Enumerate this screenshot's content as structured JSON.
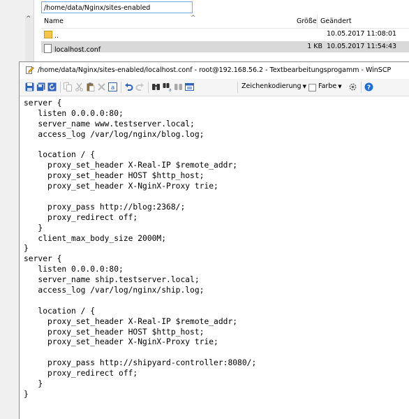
{
  "file_panel": {
    "path": "/home/data/Nginx/sites-enabled",
    "columns": {
      "name": "Name",
      "size": "Größe",
      "changed": "Geändert"
    },
    "rows": [
      {
        "name": "..",
        "size": "",
        "changed": "10.05.2017 11:08:01"
      },
      {
        "name": "localhost.conf",
        "size": "1 KB",
        "changed": "10.05.2017 11:54:43"
      }
    ]
  },
  "editor": {
    "title": "/home/data/Nginx/sites-enabled/localhost.conf - root@192.168.56.2 - Textbearbeitungsprogamm - WinSCP",
    "toolbar": {
      "encoding_label": "Zeichenkodierung",
      "color_label": "Farbe",
      "icons": [
        "save-icon",
        "save-all-icon",
        "reload-icon",
        "copy-icon",
        "cut-icon",
        "paste-icon",
        "delete-icon",
        "select-all-icon",
        "undo-icon",
        "redo-icon",
        "find-icon",
        "replace-icon",
        "find-next-icon",
        "goto-line-icon",
        "settings-icon",
        "help-icon"
      ]
    },
    "lines": [
      "server {",
      "   listen 0.0.0.0:80;",
      "   server_name www.testserver.local;",
      "   access_log /var/log/nginx/blog.log;",
      "",
      "   location / {",
      "     proxy_set_header X-Real-IP $remote_addr;",
      "     proxy_set_header HOST $http_host;",
      "     proxy_set_header X-NginX-Proxy trie;",
      "",
      "     proxy_pass http://blog:2368/;",
      "     proxy_redirect off;",
      "   }",
      "   client_max_body_size 2000M;",
      "}",
      "server {",
      "   listen 0.0.0.0:80;",
      "   server_name ship.testserver.local;",
      "   access_log /var/log/nginx/ship.log;",
      "",
      "   location / {",
      "     proxy_set_header X-Real-IP $remote_addr;",
      "     proxy_set_header HOST $http_host;",
      "     proxy_set_header X-NginX-Proxy trie;",
      "",
      "     proxy_pass http://shipyard-controller:8080/;",
      "     proxy_redirect off;",
      "   }",
      "}"
    ]
  }
}
